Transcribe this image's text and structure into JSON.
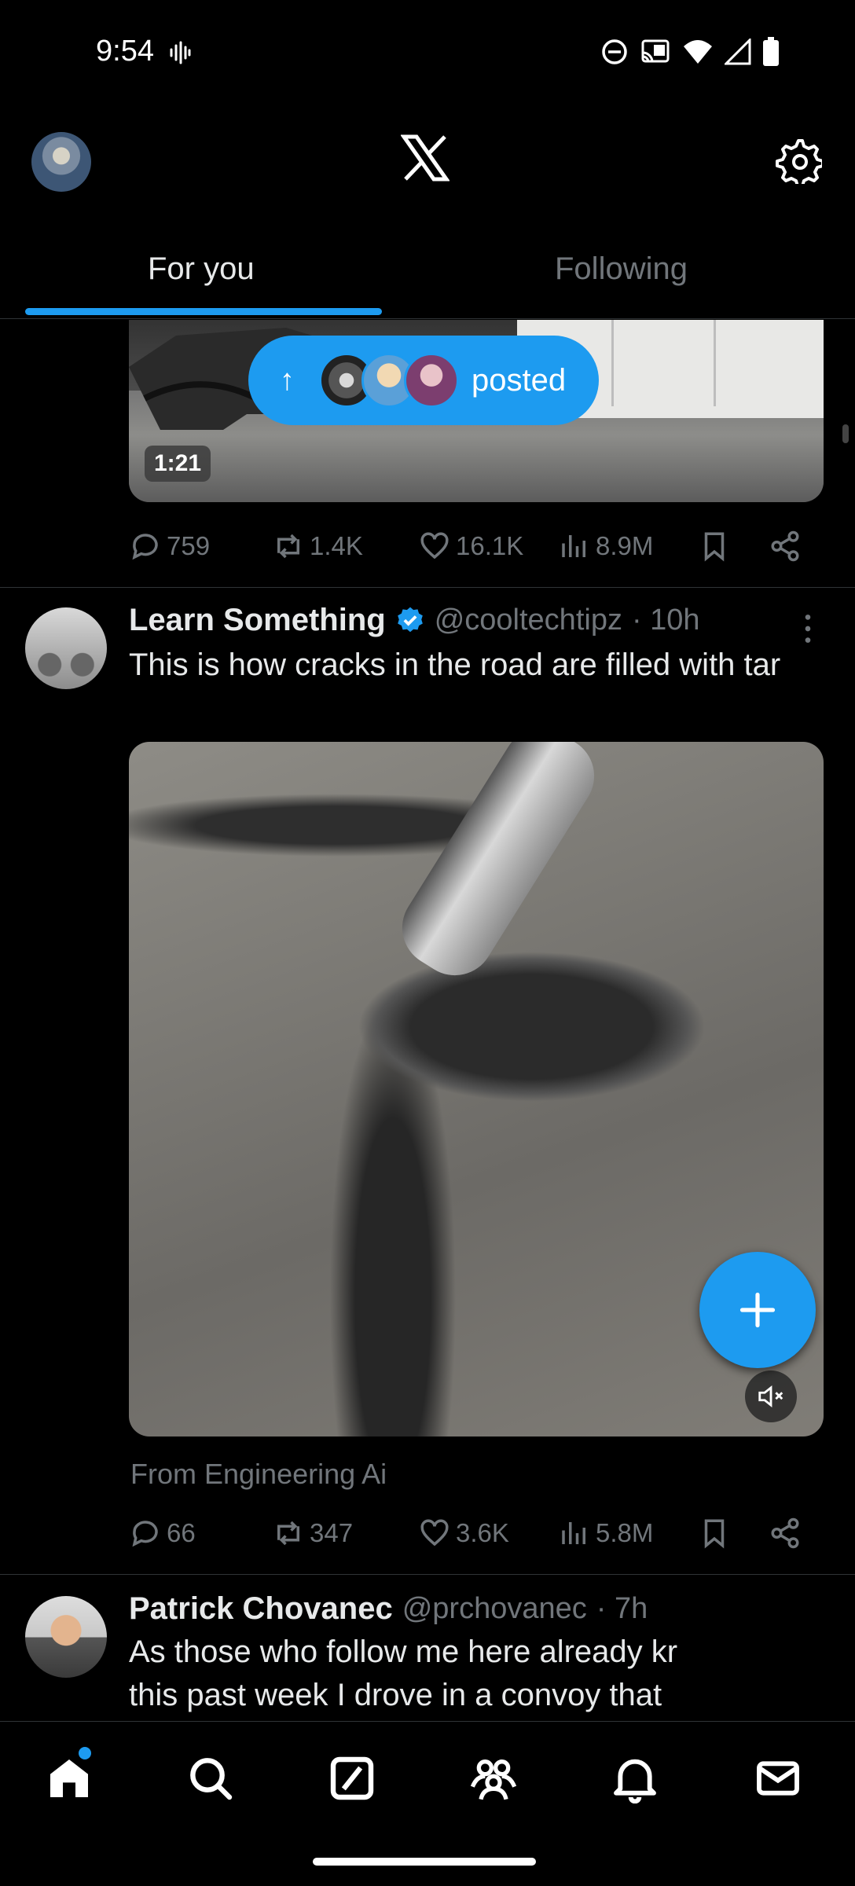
{
  "status_bar": {
    "time": "9:54"
  },
  "header": {
    "tabs": [
      {
        "label": "For you",
        "active": true
      },
      {
        "label": "Following",
        "active": false
      }
    ]
  },
  "posted_pill": {
    "label": "posted"
  },
  "first_post": {
    "video_duration": "1:21",
    "stats": {
      "replies": "759",
      "reposts": "1.4K",
      "likes": "16.1K",
      "views": "8.9M"
    }
  },
  "second_post": {
    "author_name": "Learn Something",
    "handle": "@cooltechtipz",
    "time": "· 10h",
    "verified": true,
    "text": "This is how cracks in the road are filled with tar",
    "source": "From Engineering Ai",
    "stats": {
      "replies": "66",
      "reposts": "347",
      "likes": "3.6K",
      "views": "5.8M"
    }
  },
  "third_post": {
    "author_name": "Patrick Chovanec",
    "handle": "@prchovanec",
    "time": "· 7h",
    "text_line1": "As those who follow me here already kr",
    "text_line2": "this past week I drove in a convoy that"
  },
  "colors": {
    "accent": "#1d9bf0",
    "background": "#000000",
    "muted": "#71767b",
    "text": "#e7e9ea"
  },
  "icons": [
    "x-logo-icon",
    "gear-icon",
    "reply-icon",
    "repost-icon",
    "like-icon",
    "views-icon",
    "bookmark-icon",
    "share-icon",
    "more-icon",
    "mute-icon",
    "plus-icon",
    "home-icon",
    "search-icon",
    "grok-icon",
    "communities-icon",
    "notifications-icon",
    "messages-icon"
  ]
}
